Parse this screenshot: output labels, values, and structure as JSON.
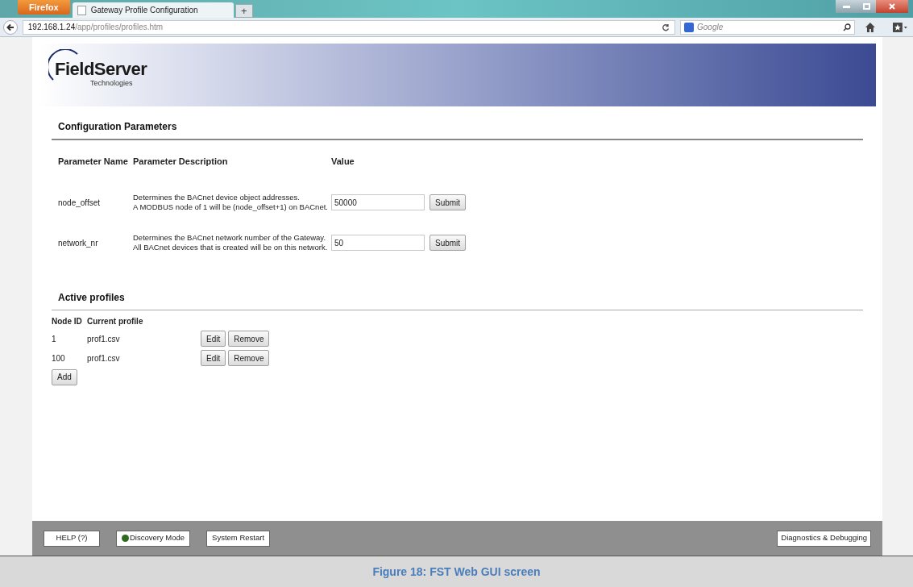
{
  "browser": {
    "menu_button": "Firefox",
    "tab_title": "Gateway Profile Configuration",
    "new_tab": "+",
    "url_host": "192.168.1.24",
    "url_path": "/app/profiles/profiles.htm",
    "search_placeholder": "Google"
  },
  "banner": {
    "logo_name": "FieldServer",
    "logo_sub": "Technologies"
  },
  "config": {
    "heading": "Configuration Parameters",
    "columns": [
      "Parameter Name",
      "Parameter Description",
      "Value"
    ],
    "rows": [
      {
        "name": "node_offset",
        "description": [
          "Determines the BACnet device object addresses.",
          "A MODBUS node of 1 will be (node_offset+1) on BACnet."
        ],
        "value": "50000",
        "button": "Submit"
      },
      {
        "name": "network_nr",
        "description": [
          "Determines the BACnet network number of the Gateway.",
          "All BACnet devices that is created will be on this network."
        ],
        "value": "50",
        "button": "Submit"
      }
    ]
  },
  "profiles": {
    "heading": "Active profiles",
    "columns": [
      "Node ID",
      "Current profile"
    ],
    "rows": [
      {
        "node_id": "1",
        "profile": "prof1.csv",
        "buttons": [
          "Edit",
          "Remove"
        ]
      },
      {
        "node_id": "100",
        "profile": "prof1.csv",
        "buttons": [
          "Edit",
          "Remove"
        ]
      }
    ],
    "add_button": "Add"
  },
  "footer": {
    "buttons": [
      {
        "label": "HELP (?)",
        "kind": "plain"
      },
      {
        "label": "Discovery Mode",
        "kind": "indicator"
      },
      {
        "label": "System Restart",
        "kind": "plain"
      }
    ],
    "right_button": "Diagnostics & Debugging"
  },
  "caption": "Figure 18: FST Web GUI screen"
}
